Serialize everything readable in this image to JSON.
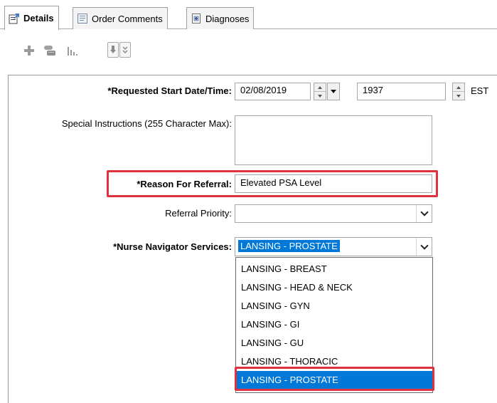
{
  "tabs": [
    {
      "label": "Details",
      "icon": "details-icon",
      "active": true
    },
    {
      "label": "Order Comments",
      "icon": "comments-icon",
      "active": false
    },
    {
      "label": "Diagnoses",
      "icon": "diagnoses-icon",
      "active": false
    }
  ],
  "toolbar": {
    "icons": [
      "add-icon",
      "copy-icon",
      "chart-icon",
      "download-icon",
      "expand-icon"
    ]
  },
  "form": {
    "requested_start": {
      "label": "*Requested Start Date/Time:",
      "date": "02/08/2019",
      "time": "1937",
      "timezone": "EST"
    },
    "special_instructions": {
      "label": "Special Instructions (255 Character Max):",
      "value": ""
    },
    "reason_for_referral": {
      "label": "*Reason For Referral:",
      "value": "Elevated PSA Level"
    },
    "referral_priority": {
      "label": "Referral Priority:",
      "value": ""
    },
    "nurse_navigator": {
      "label": "*Nurse Navigator Services:",
      "value": "LANSING - PROSTATE",
      "options": [
        "LANSING - BREAST",
        "LANSING - HEAD & NECK",
        "LANSING - GYN",
        "LANSING - GI",
        "LANSING - GU",
        "LANSING - THORACIC",
        "LANSING - PROSTATE"
      ],
      "selected_index": 6
    }
  },
  "colors": {
    "highlight_box": "#e0323e",
    "selection": "#0078d7"
  }
}
